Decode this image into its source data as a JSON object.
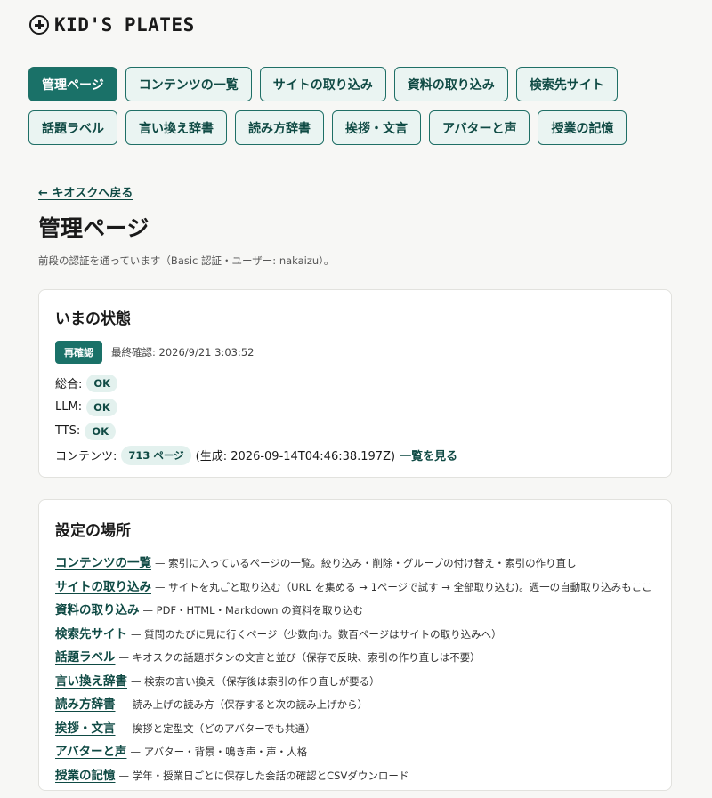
{
  "brand": {
    "name": "KID'S PLATES",
    "icon": "plus-circle-icon"
  },
  "nav": {
    "items": [
      {
        "label": "管理ページ",
        "active": true
      },
      {
        "label": "コンテンツの一覧",
        "active": false
      },
      {
        "label": "サイトの取り込み",
        "active": false
      },
      {
        "label": "資料の取り込み",
        "active": false
      },
      {
        "label": "検索先サイト",
        "active": false
      },
      {
        "label": "話題ラベル",
        "active": false
      },
      {
        "label": "言い換え辞書",
        "active": false
      },
      {
        "label": "読み方辞書",
        "active": false
      },
      {
        "label": "挨拶・文言",
        "active": false
      },
      {
        "label": "アバターと声",
        "active": false
      },
      {
        "label": "授業の記憶",
        "active": false
      }
    ]
  },
  "main": {
    "back_link": "← キオスクへ戻る",
    "title": "管理ページ",
    "auth_note": "前段の認証を通っています（Basic 認証・ユーザー: nakaizu）。"
  },
  "status": {
    "title": "いまの状態",
    "recheck_label": "再確認",
    "last_checked": "最終確認: 2026/9/21 3:03:52",
    "overall_label": "総合:",
    "overall_value": "OK",
    "llm_label": "LLM:",
    "llm_value": "OK",
    "tts_label": "TTS:",
    "tts_value": "OK",
    "contents_label": "コンテンツ:",
    "contents_count": "713 ページ",
    "contents_generated": "(生成: 2026-09-14T04:46:38.197Z)",
    "view_list_link": "一覧を見る"
  },
  "settings": {
    "title": "設定の場所",
    "items": [
      {
        "link": "コンテンツの一覧",
        "desc": "— 索引に入っているページの一覧。絞り込み・削除・グループの付け替え・索引の作り直し"
      },
      {
        "link": "サイトの取り込み",
        "desc": "— サイトを丸ごと取り込む（URL を集める → 1ページで試す → 全部取り込む)。週一の自動取り込みもここ"
      },
      {
        "link": "資料の取り込み",
        "desc": "— PDF・HTML・Markdown の資料を取り込む"
      },
      {
        "link": "検索先サイト",
        "desc": "— 質問のたびに見に行くページ（少数向け。数百ページはサイトの取り込みへ）"
      },
      {
        "link": "話題ラベル",
        "desc": "— キオスクの話題ボタンの文言と並び（保存で反映、索引の作り直しは不要）"
      },
      {
        "link": "言い換え辞書",
        "desc": "— 検索の言い換え（保存後は索引の作り直しが要る）"
      },
      {
        "link": "読み方辞書",
        "desc": "— 読み上げの読み方（保存すると次の読み上げから）"
      },
      {
        "link": "挨拶・文言",
        "desc": "— 挨拶と定型文（どのアバターでも共通）"
      },
      {
        "link": "アバターと声",
        "desc": "— アバター・背景・鳴き声・声・人格"
      },
      {
        "link": "授業の記憶",
        "desc": "— 学年・授業日ごとに保存した会話の確認とCSVダウンロード"
      }
    ]
  }
}
